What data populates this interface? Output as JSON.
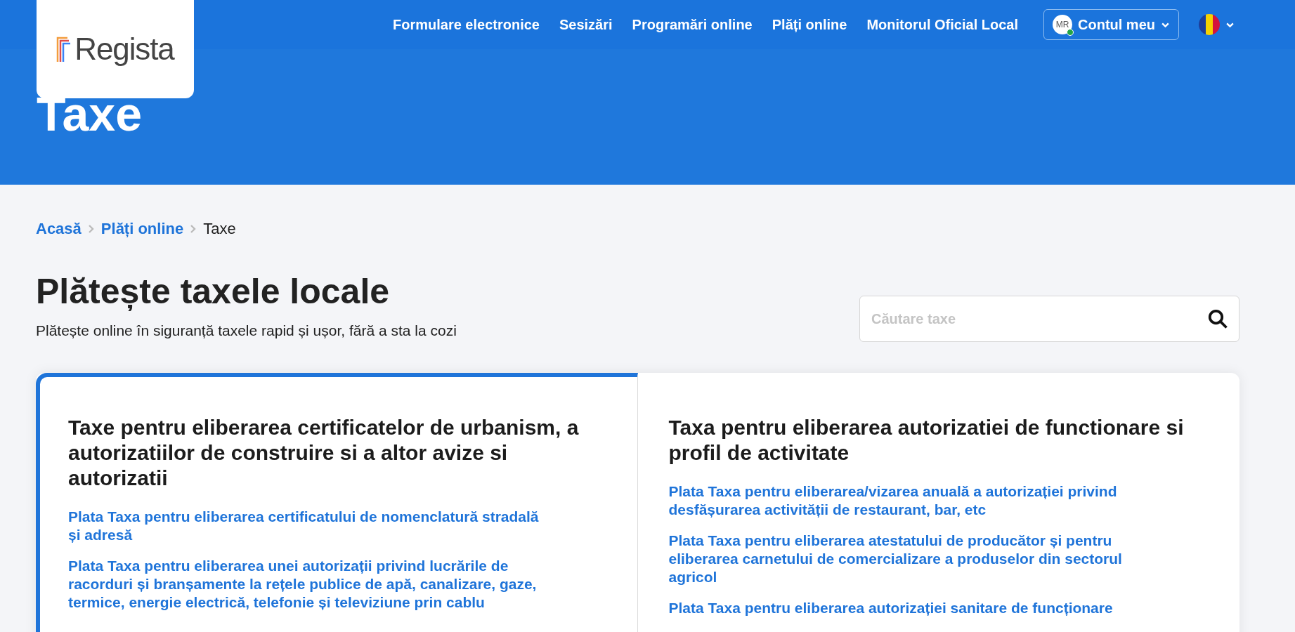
{
  "header": {
    "logo": "Regista",
    "nav": [
      "Formulare electronice",
      "Sesizări",
      "Programări online",
      "Plăți online",
      "Monitorul Oficial Local"
    ],
    "account": {
      "initials": "MR",
      "online": true,
      "label": "Contul meu"
    }
  },
  "hero": {
    "title": "Taxe"
  },
  "breadcrumb": [
    {
      "label": "Acasă",
      "link": true
    },
    {
      "label": "Plăți online",
      "link": true
    },
    {
      "label": "Taxe",
      "link": false
    }
  ],
  "page": {
    "title": "Plătește taxele locale",
    "subtitle": "Plătește online în siguranță taxele rapid și ușor, fără a sta la cozi"
  },
  "search": {
    "placeholder": "Căutare taxe"
  },
  "categories": [
    {
      "title": "Taxe pentru eliberarea certificatelor de urbanism, a autorizatiilor de construire si a altor avize si autorizatii",
      "highlighted": true,
      "links": [
        "Plata Taxa pentru eliberarea certificatului de nomenclatură stradală și adresă",
        "Plata Taxa pentru eliberarea unei autorizații privind lucrările de racorduri și branșamente la rețele publice de apă, canalizare, gaze, termice, energie electrică, telefonie și televiziune prin cablu"
      ]
    },
    {
      "title": "Taxa pentru eliberarea autorizatiei de functionare si profil de activitate",
      "highlighted": false,
      "links": [
        "Plata Taxa pentru eliberarea/vizarea anuală a autorizației privind desfășurarea activității de restaurant, bar, etc",
        "Plata Taxa pentru eliberarea atestatului de producător și pentru eliberarea carnetului de comercializare a produselor din sectorul agricol",
        "Plata Taxa pentru eliberarea autorizației sanitare de funcționare"
      ]
    }
  ]
}
